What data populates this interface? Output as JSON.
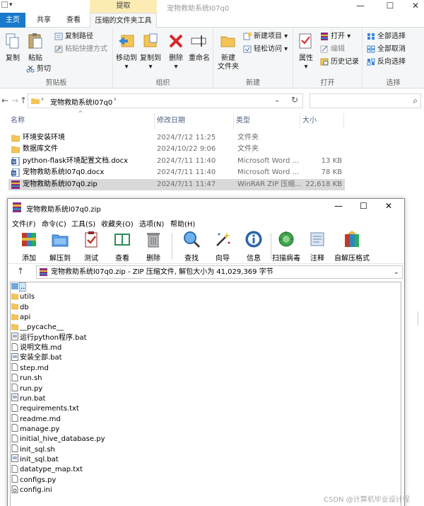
{
  "explorer": {
    "window_title": "宠物救助系统l07q0",
    "context_tab_header": "提取",
    "tabs": [
      "主页",
      "共享",
      "查看",
      "压缩的文件夹工具"
    ],
    "ribbon": {
      "clipboard": {
        "label": "剪贴板",
        "copy": "复制",
        "paste": "粘贴",
        "copy_path": "复制路径",
        "paste_shortcut": "粘贴快捷方式",
        "cut": "剪切"
      },
      "organize": {
        "label": "组织",
        "move_to": "移动到",
        "copy_to": "复制到",
        "delete": "删除",
        "rename": "重命名"
      },
      "new": {
        "label": "新建",
        "new_folder": "新建\n文件夹",
        "new_item": "新建项目",
        "easy_access": "轻松访问"
      },
      "open": {
        "label": "打开",
        "properties": "属性",
        "open": "打开",
        "edit": "编辑",
        "history": "历史记录"
      },
      "select": {
        "label": "选择",
        "select_all": "全部选择",
        "select_none": "全部取消",
        "invert": "反向选择"
      }
    },
    "address": {
      "crumb": "宠物救助系统l07q0"
    },
    "columns": {
      "name": "名称",
      "date": "修改日期",
      "type": "类型",
      "size": "大小"
    },
    "files": [
      {
        "name": "环境安装环境",
        "date": "2024/7/12 11:25",
        "type": "文件夹",
        "size": "",
        "icon": "folder"
      },
      {
        "name": "数据库文件",
        "date": "2024/10/22 9:06",
        "type": "文件夹",
        "size": "",
        "icon": "folder"
      },
      {
        "name": "python-flask环境配置文档.docx",
        "date": "2024/7/11 11:40",
        "type": "Microsoft Word ...",
        "size": "13 KB",
        "icon": "word"
      },
      {
        "name": "宠物救助系统l07q0.docx",
        "date": "2024/7/11 11:40",
        "type": "Microsoft Word ...",
        "size": "78 KB",
        "icon": "word"
      },
      {
        "name": "宠物救助系统l07q0.zip",
        "date": "2024/7/11 11:47",
        "type": "WinRAR ZIP 压缩...",
        "size": "22,618 KB",
        "icon": "rar"
      }
    ]
  },
  "winrar": {
    "title": "宠物救助系统l07q0.zip",
    "menu": [
      "文件(F)",
      "命令(C)",
      "工具(S)",
      "收藏夹(O)",
      "选项(N)",
      "帮助(H)"
    ],
    "tools": [
      "添加",
      "解压到",
      "测试",
      "查看",
      "删除",
      "查找",
      "向导",
      "信息",
      "扫描病毒",
      "注释",
      "自解压格式"
    ],
    "path": "宠物救助系统l07q0.zip - ZIP 压缩文件, 解包大小为 41,029,369 字节",
    "items": [
      {
        "name": "..",
        "icon": "up"
      },
      {
        "name": "utils",
        "icon": "folder"
      },
      {
        "name": "db",
        "icon": "folder"
      },
      {
        "name": "api",
        "icon": "folder"
      },
      {
        "name": "__pycache__",
        "icon": "folder"
      },
      {
        "name": "运行python程序.bat",
        "icon": "bat"
      },
      {
        "name": "说明文档.md",
        "icon": "file"
      },
      {
        "name": "安装全部.bat",
        "icon": "bat"
      },
      {
        "name": "step.md",
        "icon": "file"
      },
      {
        "name": "run.sh",
        "icon": "file"
      },
      {
        "name": "run.py",
        "icon": "file"
      },
      {
        "name": "run.bat",
        "icon": "bat"
      },
      {
        "name": "requirements.txt",
        "icon": "file"
      },
      {
        "name": "readme.md",
        "icon": "file"
      },
      {
        "name": "manage.py",
        "icon": "file"
      },
      {
        "name": "initial_hive_database.py",
        "icon": "file"
      },
      {
        "name": "init_sql.sh",
        "icon": "file"
      },
      {
        "name": "init_sql.bat",
        "icon": "bat"
      },
      {
        "name": "datatype_map.txt",
        "icon": "file"
      },
      {
        "name": "configs.py",
        "icon": "file"
      },
      {
        "name": "config.ini",
        "icon": "ini"
      }
    ]
  },
  "watermark": "CSDN @计算机毕业设计程",
  "colors": {
    "accent": "#1979ca",
    "context_tab": "#fcecb3",
    "selection": "#d9d9d9"
  }
}
